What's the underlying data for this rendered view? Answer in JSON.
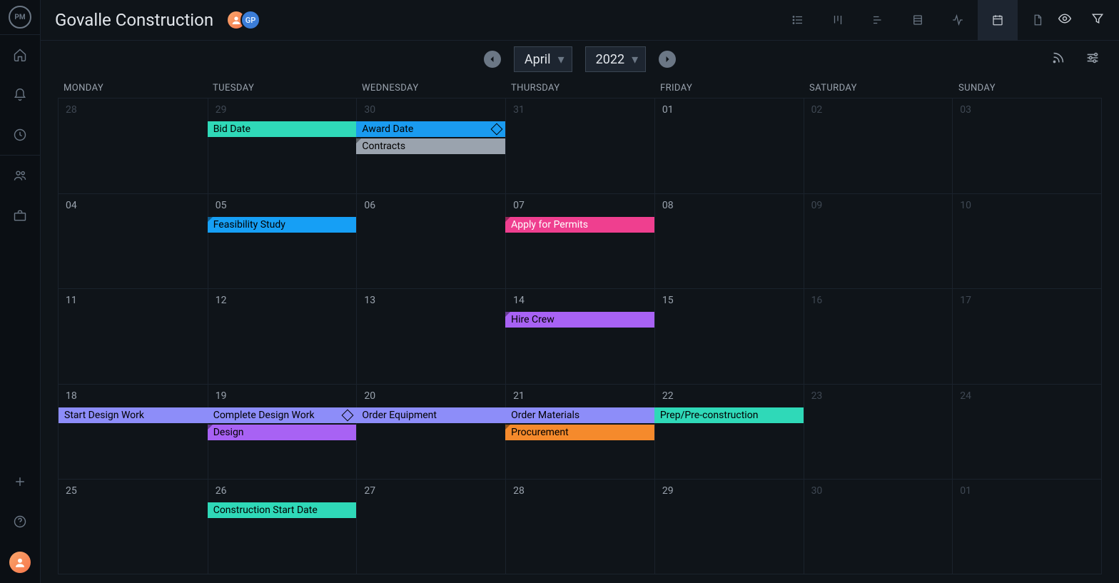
{
  "project": {
    "title": "Govalle Construction"
  },
  "avatars": {
    "gp": "GP"
  },
  "dateNav": {
    "month": "April",
    "year": "2022"
  },
  "dow": [
    "MONDAY",
    "TUESDAY",
    "WEDNESDAY",
    "THURSDAY",
    "FRIDAY",
    "SATURDAY",
    "SUNDAY"
  ],
  "colors": {
    "teal": "#2fd9b8",
    "blue": "#1a9bf0",
    "gray": "#9aa3ae",
    "pink": "#ef3f8f",
    "ltblue": "#169ff5",
    "purple": "#a862f4",
    "periwinkle": "#8d8df9",
    "orange": "#f58a2c"
  },
  "weeks": [
    {
      "days": [
        {
          "num": "28",
          "muted": true
        },
        {
          "num": "29",
          "muted": true
        },
        {
          "num": "30",
          "muted": true
        },
        {
          "num": "31",
          "muted": true
        },
        {
          "num": "01",
          "muted": false
        },
        {
          "num": "02",
          "muted": true
        },
        {
          "num": "03",
          "muted": true
        }
      ],
      "events": [
        {
          "label": "Bid Date",
          "startCol": 1,
          "span": 1,
          "row": 0,
          "color": "teal",
          "dark": true
        },
        {
          "label": "Award Date",
          "startCol": 2,
          "span": 1,
          "row": 0,
          "color": "blue",
          "dark": true,
          "diamond": true
        },
        {
          "label": "Contracts",
          "startCol": 2,
          "span": 1,
          "row": 1,
          "color": "gray",
          "dark": true,
          "folded": true
        }
      ]
    },
    {
      "days": [
        {
          "num": "04"
        },
        {
          "num": "05"
        },
        {
          "num": "06"
        },
        {
          "num": "07"
        },
        {
          "num": "08"
        },
        {
          "num": "09",
          "muted": true
        },
        {
          "num": "10",
          "muted": true
        }
      ],
      "events": [
        {
          "label": "Feasibility Study",
          "startCol": 1,
          "span": 1,
          "row": 0,
          "color": "ltblue",
          "dark": true,
          "folded": true
        },
        {
          "label": "Apply for Permits",
          "startCol": 3,
          "span": 1,
          "row": 0,
          "color": "pink",
          "white": true,
          "folded": true
        }
      ]
    },
    {
      "days": [
        {
          "num": "11"
        },
        {
          "num": "12"
        },
        {
          "num": "13"
        },
        {
          "num": "14"
        },
        {
          "num": "15"
        },
        {
          "num": "16",
          "muted": true
        },
        {
          "num": "17",
          "muted": true
        }
      ],
      "events": [
        {
          "label": "Hire Crew",
          "startCol": 3,
          "span": 1,
          "row": 0,
          "color": "purple",
          "dark": true,
          "folded": true
        }
      ]
    },
    {
      "days": [
        {
          "num": "18"
        },
        {
          "num": "19"
        },
        {
          "num": "20"
        },
        {
          "num": "21"
        },
        {
          "num": "22"
        },
        {
          "num": "23",
          "muted": true
        },
        {
          "num": "24",
          "muted": true
        }
      ],
      "events": [
        {
          "label": "Start Design Work",
          "startCol": 0,
          "span": 1,
          "row": 0,
          "color": "periwinkle",
          "dark": true
        },
        {
          "label": "Complete Design Work",
          "startCol": 1,
          "span": 1,
          "row": 0,
          "color": "periwinkle",
          "dark": true,
          "diamond": true
        },
        {
          "label": "Order Equipment",
          "startCol": 2,
          "span": 1,
          "row": 0,
          "color": "periwinkle",
          "dark": true
        },
        {
          "label": "Order Materials",
          "startCol": 3,
          "span": 1,
          "row": 0,
          "color": "periwinkle",
          "dark": true
        },
        {
          "label": "Prep/Pre-construction",
          "startCol": 4,
          "span": 1,
          "row": 0,
          "color": "teal",
          "dark": true
        },
        {
          "label": "Design",
          "startCol": 1,
          "span": 1,
          "row": 1,
          "color": "purple",
          "dark": true,
          "folded": true
        },
        {
          "label": "Procurement",
          "startCol": 3,
          "span": 1,
          "row": 1,
          "color": "orange",
          "dark": true,
          "folded": true
        }
      ]
    },
    {
      "days": [
        {
          "num": "25"
        },
        {
          "num": "26"
        },
        {
          "num": "27"
        },
        {
          "num": "28"
        },
        {
          "num": "29"
        },
        {
          "num": "30",
          "muted": true
        },
        {
          "num": "01",
          "muted": true
        }
      ],
      "events": [
        {
          "label": "Construction Start Date",
          "startCol": 1,
          "span": 1,
          "row": 0,
          "color": "teal",
          "dark": true
        }
      ]
    }
  ]
}
